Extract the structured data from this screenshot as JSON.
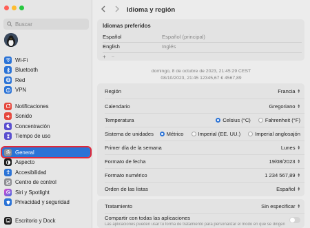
{
  "window": {
    "traffic_lights": {
      "close_color": "#ff5f57",
      "minimize_color": "#febc2e",
      "zoom_color": "#28c840"
    }
  },
  "sidebar": {
    "search_placeholder": "Buscar",
    "items": [
      {
        "label": "Wi-Fi",
        "icon": "wifi-icon",
        "color": "#2b73d6"
      },
      {
        "label": "Bluetooth",
        "icon": "bluetooth-icon",
        "color": "#2b73d6"
      },
      {
        "label": "Red",
        "icon": "network-icon",
        "color": "#2b73d6"
      },
      {
        "label": "VPN",
        "icon": "vpn-icon",
        "color": "#2b73d6"
      },
      {
        "label": "Notificaciones",
        "icon": "notifications-icon",
        "color": "#e5483d"
      },
      {
        "label": "Sonido",
        "icon": "sound-icon",
        "color": "#e5483d"
      },
      {
        "label": "Concentración",
        "icon": "focus-icon",
        "color": "#5a4fcf"
      },
      {
        "label": "Tiempo de uso",
        "icon": "screen-time-icon",
        "color": "#5a4fcf"
      },
      {
        "label": "General",
        "icon": "gear-icon",
        "color": "#8e8e93",
        "active": true
      },
      {
        "label": "Aspecto",
        "icon": "appearance-icon",
        "color": "#1f1f1f"
      },
      {
        "label": "Accesibilidad",
        "icon": "accessibility-icon",
        "color": "#2b73d6"
      },
      {
        "label": "Centro de control",
        "icon": "control-center-icon",
        "color": "#8e8e93"
      },
      {
        "label": "Siri y Spotlight",
        "icon": "siri-icon",
        "color": "#b34ad9"
      },
      {
        "label": "Privacidad y seguridad",
        "icon": "privacy-icon",
        "color": "#2b73d6"
      },
      {
        "label": "Escritorio y Dock",
        "icon": "desktop-dock-icon",
        "color": "#1f1f1f"
      }
    ]
  },
  "header": {
    "title": "Idioma y región",
    "back": "<",
    "forward": ">"
  },
  "preferred_languages": {
    "title": "Idiomas preferidos",
    "languages": [
      {
        "name": "Español",
        "note": "Español (principal)"
      },
      {
        "name": "English",
        "note": "Inglés"
      }
    ],
    "add": "+",
    "remove": "−"
  },
  "sample": {
    "line1": "domingo, 8 de octubre de 2023, 21:45:29 CEST",
    "line2": "08/10/2023, 21:45     12345,67 €     4567,89"
  },
  "settings": {
    "region": {
      "label": "Región",
      "value": "Francia"
    },
    "calendar": {
      "label": "Calendario",
      "value": "Gregoriano"
    },
    "temperature": {
      "label": "Temperatura",
      "options": [
        "Celsius (°C)",
        "Fahrenheit (°F)"
      ],
      "selected": 0
    },
    "units": {
      "label": "Sistema de unidades",
      "options": [
        "Métrico",
        "Imperial (EE. UU.)",
        "Imperial anglosajón"
      ],
      "selected": 0
    },
    "first_day": {
      "label": "Primer día de la semana",
      "value": "Lunes"
    },
    "date_format": {
      "label": "Formato de fecha",
      "value": "19/08/2023"
    },
    "number_format": {
      "label": "Formato numérico",
      "value": "1 234 567,89"
    },
    "list_order": {
      "label": "Orden de las listas",
      "value": "Español"
    },
    "treatment": {
      "label": "Tratamiento",
      "value": "Sin especificar"
    },
    "share": {
      "label": "Compartir con todas las aplicaciones",
      "description": "Las aplicaciones pueden usar tu forma de tratamiento para personalizar el modo en que se dirigen",
      "enabled": false
    }
  },
  "colors": {
    "accent": "#2b73d6",
    "highlight_box": "#e0283a",
    "annotation_arrow": "#e0283a"
  }
}
